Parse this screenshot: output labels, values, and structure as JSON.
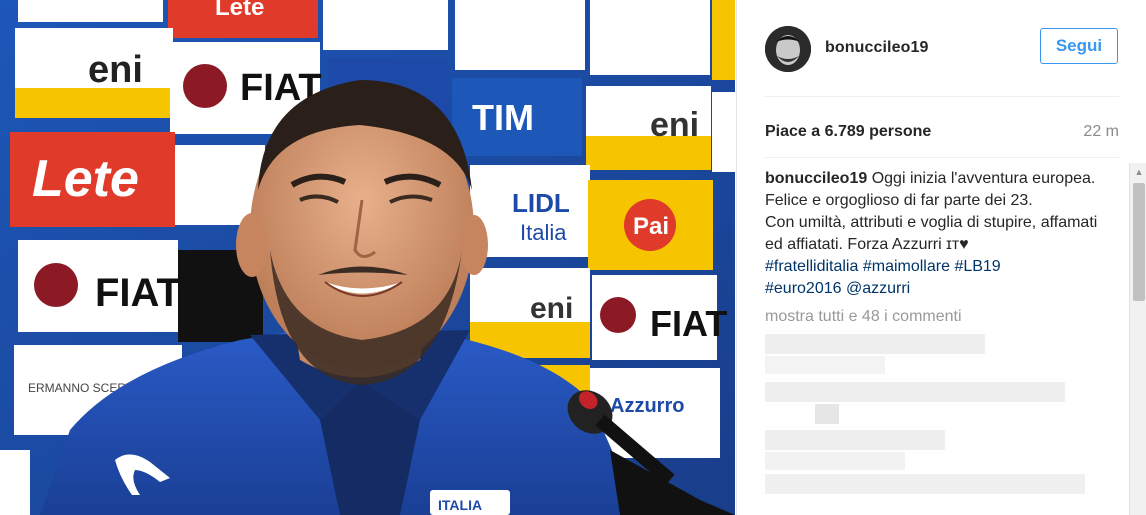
{
  "post": {
    "username": "bonuccileo19",
    "follow_label": "Segui",
    "likes": "Piace a 6.789 persone",
    "time_ago": "22 m",
    "caption": {
      "user": "bonuccileo19",
      "line1": "Oggi inizia l'avventura europea. Felice e orgoglioso di far parte dei 23.",
      "line2": "Con umiltà, attributi e voglia di stupire, affamati ed affiatati. Forza Azzurri",
      "flag_heart": "ɪᴛ♥",
      "tags": [
        "#fratelliditalia",
        "#maimollare",
        "#LB19",
        "#euro2016",
        "@azzurri"
      ]
    },
    "more_comments": "mostra tutti e 48 i commenti"
  },
  "photo": {
    "sponsors": [
      "eni",
      "FIAT",
      "TIM",
      "LIDL Italia",
      "Lete",
      "Puma",
      "Pai",
      "Ermanno Scervino"
    ],
    "logo_texts": {
      "eni": "eni",
      "fiat": "FIAT",
      "tim": "TIM",
      "lidl": "LIDL",
      "italia": "Italia",
      "lete": "Lete",
      "pai": "Pai",
      "scervino": "ERMANNO SCERVINO",
      "jersey": "ITALIA",
      "lidl_alt": "Azzurro"
    }
  },
  "colors": {
    "accent": "#3897f0",
    "tag": "#003569",
    "backdrop_blue": "#1f3f86",
    "lete_red": "#e03a2a",
    "eni_yellow": "#f6c500"
  }
}
